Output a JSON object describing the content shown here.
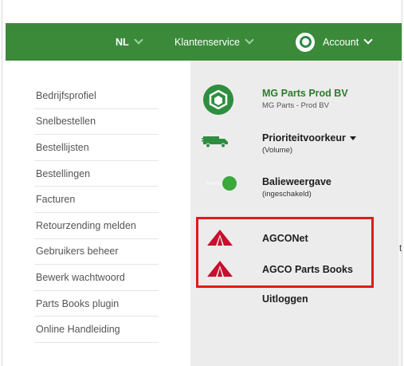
{
  "navbar": {
    "language": "NL",
    "customer_service": "Klantenservice",
    "account": "Account"
  },
  "left_menu": {
    "items": [
      "Bedrijfsprofiel",
      "Snelbestellen",
      "Bestellijsten",
      "Bestellingen",
      "Facturen",
      "Retourzending melden",
      "Gebruikers beheer",
      "Bewerk wachtwoord",
      "Parts Books plugin",
      "Online Handleiding"
    ]
  },
  "account_menu": {
    "company_name": "MG Parts Prod BV",
    "company_sub": "MG Parts - Prod BV",
    "priority_label": "Prioriteitvoorkeur",
    "priority_value": "(Volume)",
    "counter_label": "Balieweergave",
    "counter_value": "(ingeschakeld)",
    "agconet": "AGCONet",
    "agco_parts_books": "AGCO Parts Books",
    "logout": "Uitloggen"
  },
  "colors": {
    "nav_green": "#3a8a3a",
    "highlight_red": "#e01b1b",
    "agco_red": "#c8102e"
  },
  "right_edge_char": "t"
}
